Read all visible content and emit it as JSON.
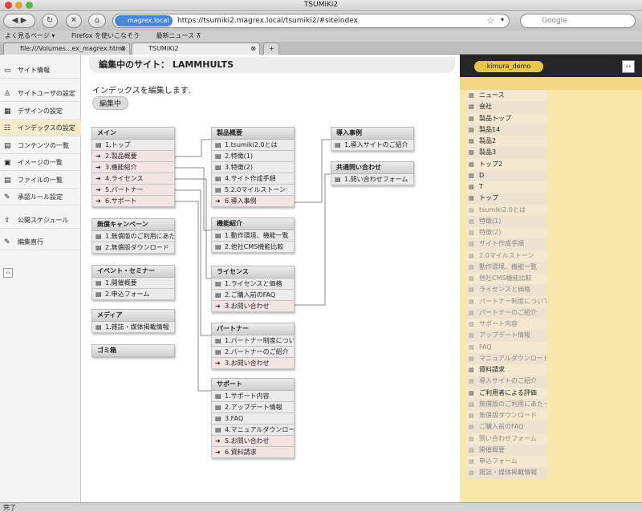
{
  "window": {
    "title": "TSUMiKi2"
  },
  "nav": {
    "site_badge": "magrex.local",
    "url": "https://tsumiki2.magrex.local/tsumiki2/#siteindex",
    "search_placeholder": "Google"
  },
  "bookmarks": [
    "よく見るページ ▾",
    "Firefox を使いこなそう",
    "最新ニュース ⊼"
  ],
  "tabs": [
    {
      "label": "file:///Volumes...ex_magrex.html"
    },
    {
      "label": "TSUMiKi2"
    }
  ],
  "sidebar": {
    "items": [
      {
        "label": "サイト情報",
        "icon": "document-icon"
      },
      {
        "label": "サイトユーザの設定",
        "icon": "user-icon"
      },
      {
        "label": "デザインの設定",
        "icon": "layout-icon"
      },
      {
        "label": "インデックスの設定",
        "icon": "tree-icon"
      },
      {
        "label": "コンテンツの一覧",
        "icon": "list-icon"
      },
      {
        "label": "イメージの一覧",
        "icon": "image-icon"
      },
      {
        "label": "ファイルの一覧",
        "icon": "file-icon"
      },
      {
        "label": "承認ルール設定",
        "icon": "approve-icon"
      },
      {
        "label": "公開スケジュール",
        "icon": "upload-icon"
      },
      {
        "label": "編集直行",
        "icon": "pencil-icon"
      }
    ],
    "toggle": "‹›"
  },
  "main": {
    "site_label": "編集中のサイト： LAMMHULTS",
    "intro": "インデックスを編集します.",
    "edit_button": "編集中"
  },
  "boxes": [
    {
      "title": "メイン",
      "rows": [
        {
          "t": "1.トップ",
          "k": "doc"
        },
        {
          "t": "2.製品概要",
          "k": "link"
        },
        {
          "t": "3.機能紹介",
          "k": "link"
        },
        {
          "t": "4.ライセンス",
          "k": "link"
        },
        {
          "t": "5.パートナー",
          "k": "link"
        },
        {
          "t": "6.サポート",
          "k": "link"
        }
      ]
    },
    {
      "title": "無償キャンペーン",
      "rows": [
        {
          "t": "1.無償版のご利用にあた",
          "k": "doc"
        },
        {
          "t": "2.無償版ダウンロード",
          "k": "doc"
        }
      ]
    },
    {
      "title": "イベント・セミナー",
      "rows": [
        {
          "t": "1.開催概要",
          "k": "doc"
        },
        {
          "t": "2.申込フォーム",
          "k": "doc"
        }
      ]
    },
    {
      "title": "メディア",
      "rows": [
        {
          "t": "1.雑誌・媒体掲載情報",
          "k": "doc"
        }
      ]
    },
    {
      "title": "ゴミ箱",
      "rows": []
    },
    {
      "title": "製品概要",
      "rows": [
        {
          "t": "1.tsumiki2.0とは",
          "k": "doc"
        },
        {
          "t": "2.特徴(1)",
          "k": "doc"
        },
        {
          "t": "3.特徴(2)",
          "k": "doc"
        },
        {
          "t": "4.サイト作成手順",
          "k": "doc"
        },
        {
          "t": "5.2.0マイルストーン",
          "k": "doc"
        },
        {
          "t": "6.導入事例",
          "k": "link"
        }
      ]
    },
    {
      "title": "機能紹介",
      "rows": [
        {
          "t": "1.動作環境、機能一覧",
          "k": "doc"
        },
        {
          "t": "2.他社CMS機能比較",
          "k": "doc"
        }
      ]
    },
    {
      "title": "ライセンス",
      "rows": [
        {
          "t": "1.ライセンスと価格",
          "k": "doc"
        },
        {
          "t": "2.ご購入前のFAQ",
          "k": "doc"
        },
        {
          "t": "3.お問い合わせ",
          "k": "link"
        }
      ]
    },
    {
      "title": "パートナー",
      "rows": [
        {
          "t": "1.パートナー制度につい",
          "k": "doc"
        },
        {
          "t": "2.パートナーのご紹介",
          "k": "doc"
        },
        {
          "t": "3.お問い合わせ",
          "k": "link"
        }
      ]
    },
    {
      "title": "サポート",
      "rows": [
        {
          "t": "1.サポート内容",
          "k": "doc"
        },
        {
          "t": "2.アップデート情報",
          "k": "doc"
        },
        {
          "t": "3.FAQ",
          "k": "doc"
        },
        {
          "t": "4.マニュアルダウンロー",
          "k": "doc"
        },
        {
          "t": "5.お問い合わせ",
          "k": "link"
        },
        {
          "t": "6.資料請求",
          "k": "link"
        }
      ]
    },
    {
      "title": "導入事例",
      "rows": [
        {
          "t": "1.導入サイトのご紹介",
          "k": "doc"
        }
      ]
    },
    {
      "title": "共通問い合わせ",
      "rows": [
        {
          "t": "1.問い合わせフォーム",
          "k": "doc"
        }
      ]
    }
  ],
  "right": {
    "user": "kimura_demo",
    "toggle": "‹›",
    "pages": [
      {
        "t": "ニュース",
        "g": false
      },
      {
        "t": "会社",
        "g": false
      },
      {
        "t": "製品トップ",
        "g": false
      },
      {
        "t": "製品14",
        "g": false
      },
      {
        "t": "製品2",
        "g": false
      },
      {
        "t": "製品3",
        "g": false
      },
      {
        "t": "トップ2",
        "g": false
      },
      {
        "t": "D",
        "g": false
      },
      {
        "t": "T",
        "g": false
      },
      {
        "t": "トップ",
        "g": false
      },
      {
        "t": "tsumiki2.0とは",
        "g": true
      },
      {
        "t": "特徴(1)",
        "g": true
      },
      {
        "t": "特徴(2)",
        "g": true
      },
      {
        "t": "サイト作成手順",
        "g": true
      },
      {
        "t": "2.0マイルストーン",
        "g": true
      },
      {
        "t": "動作環境、機能一覧",
        "g": true
      },
      {
        "t": "他社CMS機能比較",
        "g": true
      },
      {
        "t": "ライセンスと価格",
        "g": true
      },
      {
        "t": "パートナー制度について",
        "g": true
      },
      {
        "t": "パートナーのご紹介",
        "g": true
      },
      {
        "t": "サポート内容",
        "g": true
      },
      {
        "t": "アップデート情報",
        "g": true
      },
      {
        "t": "FAQ",
        "g": true
      },
      {
        "t": "マニュアルダウンロード",
        "g": true
      },
      {
        "t": "資料請求",
        "g": false
      },
      {
        "t": "導入サイトのご紹介",
        "g": true
      },
      {
        "t": "ご利用者による評価",
        "g": false
      },
      {
        "t": "無償版のご利用にあたって",
        "g": true
      },
      {
        "t": "無償版ダウンロード",
        "g": true
      },
      {
        "t": "ご購入前のFAQ",
        "g": true
      },
      {
        "t": "問い合わせフォーム",
        "g": true
      },
      {
        "t": "開催概要",
        "g": true
      },
      {
        "t": "申込フォーム",
        "g": true
      },
      {
        "t": "雑誌・媒体掲載情報",
        "g": true
      }
    ]
  },
  "status": {
    "text": "完了"
  }
}
